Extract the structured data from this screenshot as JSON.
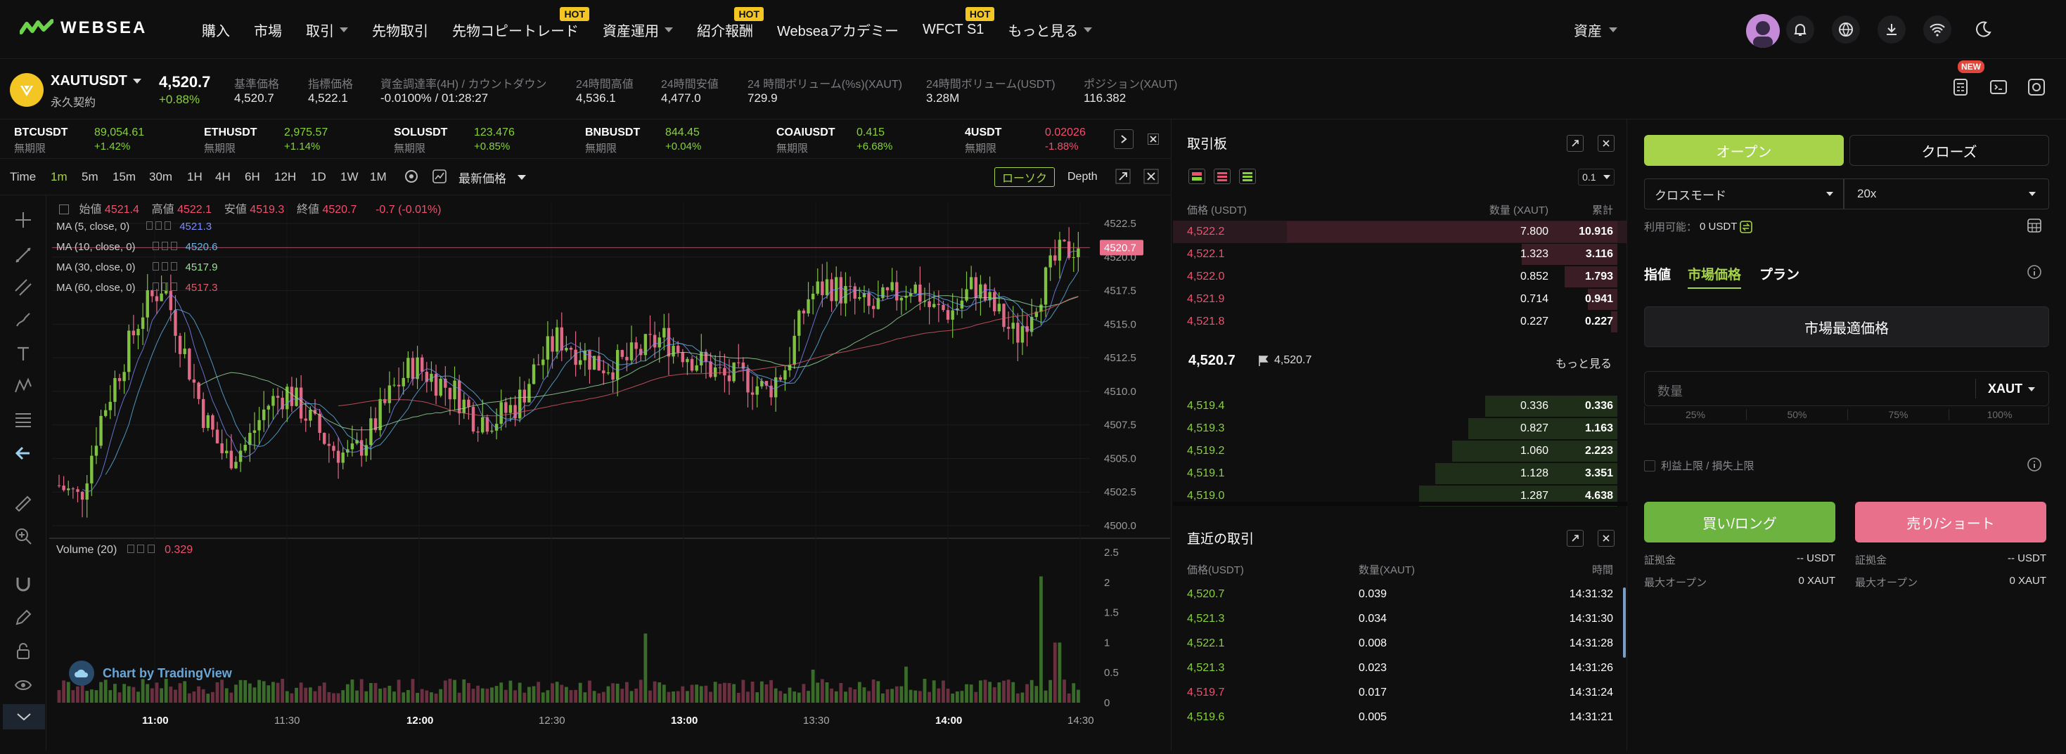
{
  "brand": {
    "name": "WEBSEA"
  },
  "nav": {
    "items": [
      {
        "label": "購入",
        "caret": false,
        "hot": false
      },
      {
        "label": "市場",
        "caret": false,
        "hot": false
      },
      {
        "label": "取引",
        "caret": true,
        "hot": false
      },
      {
        "label": "先物取引",
        "caret": false,
        "hot": false
      },
      {
        "label": "先物コピートレード",
        "caret": false,
        "hot": true
      },
      {
        "label": "資産運用",
        "caret": true,
        "hot": false
      },
      {
        "label": "紹介報酬",
        "caret": false,
        "hot": true
      },
      {
        "label": "Webseaアカデミー",
        "caret": false,
        "hot": false
      },
      {
        "label": "WFCT S1",
        "caret": false,
        "hot": true
      },
      {
        "label": "もっと見る",
        "caret": true,
        "hot": false
      }
    ],
    "hot_badge": "HOT",
    "assets_label": "資産"
  },
  "ticker": {
    "symbol": "XAUTUSDT",
    "contract": "永久契約",
    "price": "4,520.7",
    "change": "+0.88%",
    "stats": [
      {
        "label": "基準価格",
        "value": "4,520.7"
      },
      {
        "label": "指標価格",
        "value": "4,522.1"
      },
      {
        "label": "資金調達率(4H) / カウントダウン",
        "value": "-0.0100% / 01:28:27"
      },
      {
        "label": "24時間高値",
        "value": "4,536.1"
      },
      {
        "label": "24時間安値",
        "value": "4,477.0"
      },
      {
        "label": "24 時間ボリューム(%s)(XAUT)",
        "value": "729.9"
      },
      {
        "label": "24時間ボリューム(USDT)",
        "value": "3.28M"
      },
      {
        "label": "ポジション(XAUT)",
        "value": "116.382"
      }
    ],
    "new_badge": "NEW"
  },
  "symbols": [
    {
      "name": "BTCUSDT",
      "price": "89,054.61",
      "sub": "無期限",
      "change": "+1.42%",
      "up": true
    },
    {
      "name": "ETHUSDT",
      "price": "2,975.57",
      "sub": "無期限",
      "change": "+1.14%",
      "up": true
    },
    {
      "name": "SOLUSDT",
      "price": "123.476",
      "sub": "無期限",
      "change": "+0.85%",
      "up": true
    },
    {
      "name": "BNBUSDT",
      "price": "844.45",
      "sub": "無期限",
      "change": "+0.04%",
      "up": true
    },
    {
      "name": "COAIUSDT",
      "price": "0.415",
      "sub": "無期限",
      "change": "+6.68%",
      "up": true
    },
    {
      "name": "4USDT",
      "price": "0.02026",
      "sub": "無期限",
      "change": "-1.88%",
      "up": false
    }
  ],
  "timeframes": [
    "Time",
    "1m",
    "5m",
    "15m",
    "30m",
    "1H",
    "4H",
    "6H",
    "12H",
    "1D",
    "1W",
    "1M"
  ],
  "active_timeframe": "1m",
  "price_type": "最新価格",
  "chart_modes": {
    "candle": "ローソク",
    "depth": "Depth"
  },
  "chart_legend": {
    "open_label": "始値",
    "open": "4521.4",
    "high_label": "高値",
    "high": "4522.1",
    "low_label": "安値",
    "low": "4519.3",
    "close_label": "終値",
    "close": "4520.7",
    "change": "-0.7 (-0.01%)",
    "ma": [
      {
        "label": "MA (5, close, 0)",
        "value": "4521.3",
        "color": "#7b8cff"
      },
      {
        "label": "MA (10, close, 0)",
        "value": "4520.6",
        "color": "#62b6e8"
      },
      {
        "label": "MA (30, close, 0)",
        "value": "4517.9",
        "color": "#9be09b"
      },
      {
        "label": "MA (60, close, 0)",
        "value": "4517.3",
        "color": "#e05a6a"
      }
    ],
    "volume_label": "Volume (20)",
    "volume_value": "0.329",
    "attribution": "Chart by TradingView"
  },
  "chart_data": {
    "type": "candlestick",
    "price_ylim": [
      4500.0,
      4522.5
    ],
    "price_ticks": [
      "4522.5",
      "4520.0",
      "4517.5",
      "4515.0",
      "4512.5",
      "4510.0",
      "4507.5",
      "4505.0",
      "4502.5",
      "4500.0"
    ],
    "last_price": "4520.7",
    "volume_ylim": [
      0,
      2.5
    ],
    "volume_ticks": [
      "2.5",
      "2",
      "1.5",
      "1",
      "0.5",
      "0"
    ],
    "x_ticks": [
      "11:00",
      "11:30",
      "12:00",
      "12:30",
      "13:00",
      "13:30",
      "14:00",
      "14:30"
    ],
    "x_ticks_bold": [
      true,
      false,
      true,
      false,
      true,
      false,
      true,
      false
    ],
    "close_path": [
      4503,
      4502,
      4508,
      4512,
      4516,
      4518,
      4513,
      4508,
      4505,
      4506,
      4509,
      4510,
      4508,
      4506,
      4505,
      4507,
      4510,
      4512,
      4511,
      4510,
      4508,
      4508,
      4509,
      4512,
      4514,
      4513,
      4512,
      4512,
      4513,
      4514,
      4513,
      4512,
      4511,
      4511,
      4510,
      4512,
      4517,
      4518,
      4517,
      4516,
      4517,
      4518,
      4516,
      4516,
      4518,
      4516,
      4514,
      4517,
      4520,
      4521
    ],
    "volume_spikes": [
      {
        "at": 0.575,
        "v": 1.15
      },
      {
        "at": 0.83,
        "v": 0.6
      },
      {
        "at": 0.74,
        "v": 0.55
      },
      {
        "at": 0.965,
        "v": 2.1
      },
      {
        "at": 0.98,
        "v": 1.0
      }
    ]
  },
  "orderbook": {
    "title": "取引板",
    "precision": "0.1",
    "headers": {
      "price": "価格 (USDT)",
      "qty": "数量 (XAUT)",
      "total": "累計"
    },
    "asks": [
      {
        "price": "4,522.2",
        "qty": "7.800",
        "total": "10.916",
        "depth": 1.0
      },
      {
        "price": "4,522.1",
        "qty": "1.323",
        "total": "3.116",
        "depth": 0.29
      },
      {
        "price": "4,522.0",
        "qty": "0.852",
        "total": "1.793",
        "depth": 0.16
      },
      {
        "price": "4,521.9",
        "qty": "0.714",
        "total": "0.941",
        "depth": 0.09
      },
      {
        "price": "4,521.8",
        "qty": "0.227",
        "total": "0.227",
        "depth": 0.02
      }
    ],
    "mid_price": "4,520.7",
    "mark_price": "4,520.7",
    "more_label": "もっと見る",
    "bids": [
      {
        "price": "4,519.4",
        "qty": "0.336",
        "total": "0.336",
        "depth": 0.4
      },
      {
        "price": "4,519.3",
        "qty": "0.827",
        "total": "1.163",
        "depth": 0.45
      },
      {
        "price": "4,519.2",
        "qty": "1.060",
        "total": "2.223",
        "depth": 0.5
      },
      {
        "price": "4,519.1",
        "qty": "1.128",
        "total": "3.351",
        "depth": 0.55
      },
      {
        "price": "4,519.0",
        "qty": "1.287",
        "total": "4.638",
        "depth": 0.6
      }
    ]
  },
  "trades": {
    "title": "直近の取引",
    "headers": {
      "price": "価格(USDT)",
      "qty": "数量(XAUT)",
      "time": "時間"
    },
    "rows": [
      {
        "price": "4,520.7",
        "qty": "0.039",
        "time": "14:31:32",
        "up": true
      },
      {
        "price": "4,521.3",
        "qty": "0.034",
        "time": "14:31:30",
        "up": true
      },
      {
        "price": "4,522.1",
        "qty": "0.008",
        "time": "14:31:28",
        "up": true
      },
      {
        "price": "4,521.3",
        "qty": "0.023",
        "time": "14:31:26",
        "up": true
      },
      {
        "price": "4,519.7",
        "qty": "0.017",
        "time": "14:31:24",
        "up": false
      },
      {
        "price": "4,519.6",
        "qty": "0.005",
        "time": "14:31:21",
        "up": true
      }
    ]
  },
  "trade_form": {
    "open_tab": "オープン",
    "close_tab": "クローズ",
    "margin_mode": "クロスモード",
    "leverage": "20x",
    "available_label": "利用可能：",
    "available_value": "0 USDT",
    "order_types": [
      "指値",
      "市場価格",
      "プラン"
    ],
    "active_order_type": "市場価格",
    "market_price_label": "市場最適価格",
    "qty_placeholder": "数量",
    "qty_unit": "XAUT",
    "percents": [
      "25%",
      "50%",
      "75%",
      "100%"
    ],
    "tpsl_label": "利益上限 / 損失上限",
    "buy_label": "買い/ロング",
    "sell_label": "売り/ショート",
    "margin_label": "証拠金",
    "margin_value": "-- USDT",
    "max_open_label": "最大オープン",
    "max_open_value": "0 XAUT"
  },
  "colors": {
    "up": "#88d13b",
    "down": "#f0506e",
    "accent": "#a6d34a",
    "buy": "#6cb33f",
    "sell": "#e8708a"
  }
}
